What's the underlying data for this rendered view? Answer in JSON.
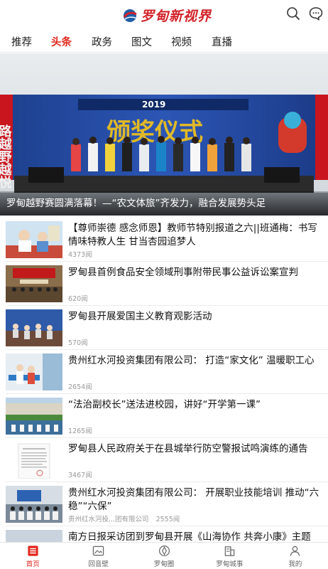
{
  "header": {
    "logo_text": "罗甸新视界",
    "logo_icon": "globe-logo-icon",
    "search_icon": "search-icon",
    "message_icon": "chat-bubble-icon",
    "brand_color": "#d2232a"
  },
  "tabs": [
    {
      "label": "推荐",
      "active": false
    },
    {
      "label": "头条",
      "active": true
    },
    {
      "label": "政务",
      "active": false
    },
    {
      "label": "图文",
      "active": false
    },
    {
      "label": "视频",
      "active": false
    },
    {
      "label": "直播",
      "active": false
    }
  ],
  "hero": {
    "caption": "罗甸越野赛圆满落幕！—“农文体旅”齐发力，融合发展势头足",
    "backdrop_year": "2019",
    "backdrop_word": "颁奖仪式",
    "backdrop_side": "路越野越悦"
  },
  "news": [
    {
      "title": "【尊师崇德 感念师恩】教师节特别报道之六||班通梅：书写情味特教人生 甘当杏园追梦人",
      "reads": "4373阅",
      "source": ""
    },
    {
      "title": "罗甸县首例食品安全领域刑事附带民事公益诉讼案宣判",
      "reads": "620阅",
      "source": ""
    },
    {
      "title": "罗甸县开展爱国主义教育观影活动",
      "reads": "570阅",
      "source": ""
    },
    {
      "title": "贵州红水河投资集团有限公司： 打造“家文化” 温暖职工心",
      "reads": "2654阅",
      "source": ""
    },
    {
      "title": "“法治副校长”送法进校园，讲好“开学第一课”",
      "reads": "1265阅",
      "source": ""
    },
    {
      "title": "罗甸县人民政府关于在县城举行防空警报试鸣演练的通告",
      "reads": "3467阅",
      "source": ""
    },
    {
      "title": "贵州红水河投资集团有限公司： 开展职业技能培训 推动“六稳”“六保”",
      "reads": "2555阅",
      "source": "贵州红水河投...团有限公司"
    },
    {
      "title": "南方日报采访团到罗甸县开展《山海协作 共奔小康》主题",
      "reads": "",
      "source": ""
    }
  ],
  "bottom_nav": [
    {
      "label": "首页",
      "icon": "home-list-icon",
      "active": true
    },
    {
      "label": "回音壁",
      "icon": "picture-frame-icon",
      "active": false
    },
    {
      "label": "罗甸圈",
      "icon": "circle-compass-icon",
      "active": false
    },
    {
      "label": "罗甸城事",
      "icon": "city-building-icon",
      "active": false
    },
    {
      "label": "我的",
      "icon": "user-icon",
      "active": false
    }
  ],
  "accent_color": "#e1261c"
}
